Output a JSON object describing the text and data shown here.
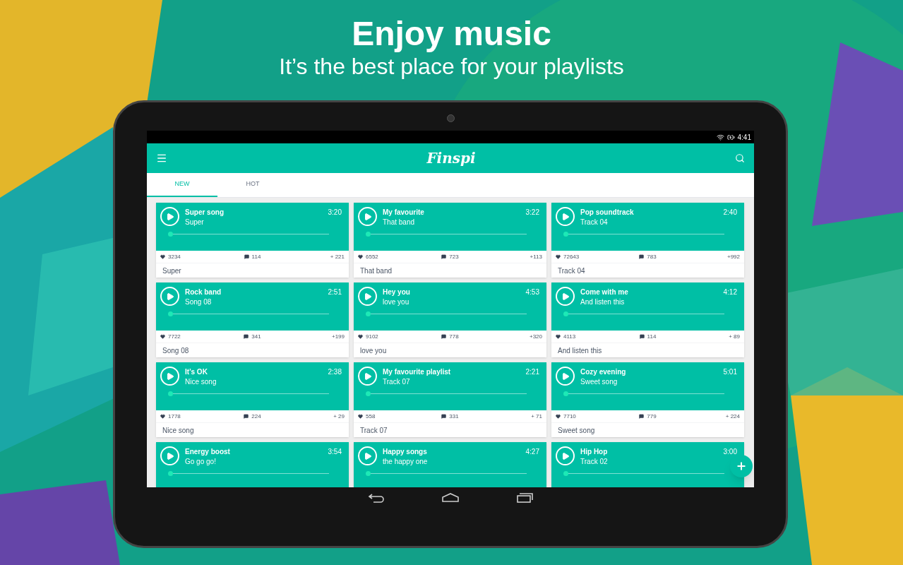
{
  "headline": {
    "title": "Enjoy music",
    "subtitle": "It’s the best place for your playlists"
  },
  "status_bar": {
    "time": "4:41"
  },
  "app_bar": {
    "logo": "Finspi"
  },
  "tabs": [
    {
      "label": "NEW",
      "selected": true
    },
    {
      "label": "HOT",
      "selected": false
    }
  ],
  "cards": [
    {
      "title": "Super song",
      "artist": "Super",
      "duration": "3:20",
      "level": 0.01,
      "likes": "3234",
      "comments": "114",
      "adds": "+ 221",
      "footer": "Super"
    },
    {
      "title": "My favourite",
      "artist": "That band",
      "duration": "3:22",
      "level": 0.01,
      "likes": "6552",
      "comments": "723",
      "adds": "+113",
      "footer": "That band"
    },
    {
      "title": "Pop soundtrack",
      "artist": "Track 04",
      "duration": "2:40",
      "level": 0.01,
      "likes": "72643",
      "comments": "783",
      "adds": "+992",
      "footer": "Track 04"
    },
    {
      "title": "Rock band",
      "artist": "Song 08",
      "duration": "2:51",
      "level": 0.01,
      "likes": "7722",
      "comments": "341",
      "adds": "+199",
      "footer": "Song 08"
    },
    {
      "title": "Hey you",
      "artist": "love you",
      "duration": "4:53",
      "level": 0.01,
      "likes": "9102",
      "comments": "778",
      "adds": "+320",
      "footer": "love you"
    },
    {
      "title": "Come with me",
      "artist": "And listen this",
      "duration": "4:12",
      "level": 0.01,
      "likes": "4113",
      "comments": "114",
      "adds": "+ 89",
      "footer": "And listen this"
    },
    {
      "title": "It’s OK",
      "artist": "Nice song",
      "duration": "2:38",
      "level": 0.01,
      "likes": "1778",
      "comments": "224",
      "adds": "+ 29",
      "footer": "Nice song"
    },
    {
      "title": "My favourite playlist",
      "artist": "Track 07",
      "duration": "2:21",
      "level": 0.01,
      "likes": "558",
      "comments": "331",
      "adds": "+ 71",
      "footer": "Track 07"
    },
    {
      "title": "Cozy evening",
      "artist": "Sweet song",
      "duration": "5:01",
      "level": 0.01,
      "likes": "7710",
      "comments": "779",
      "adds": "+ 224",
      "footer": "Sweet song"
    },
    {
      "title": "Energy boost",
      "artist": "Go go go!",
      "duration": "3:54",
      "level": 0.01
    },
    {
      "title": "Happy songs",
      "artist": "the happy one",
      "duration": "4:27",
      "level": 0.01
    },
    {
      "title": "Hip Hop",
      "artist": "Track 02",
      "duration": "3:00",
      "level": 0.01
    }
  ]
}
